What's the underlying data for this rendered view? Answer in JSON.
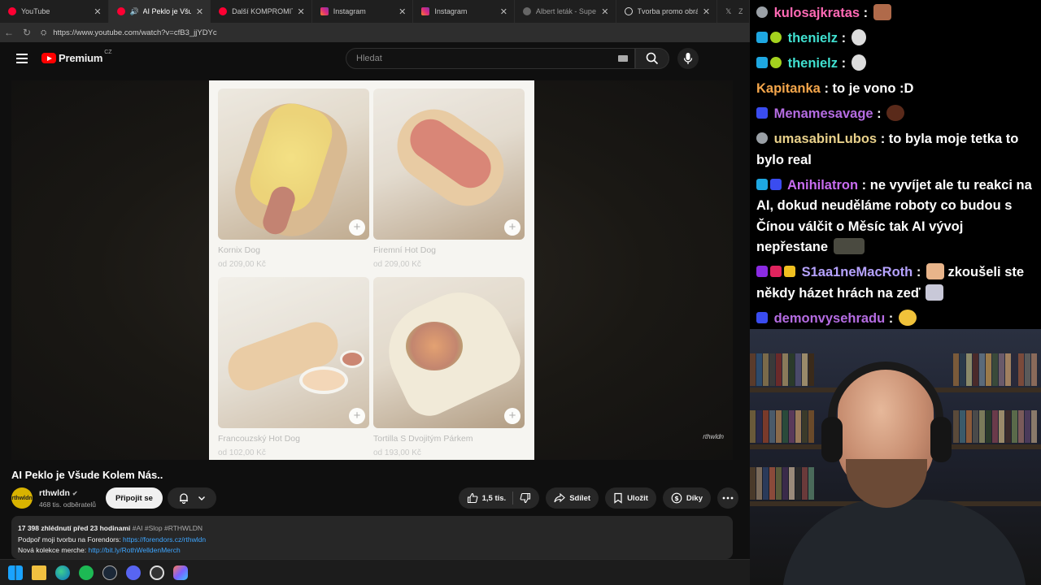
{
  "browser": {
    "tabs": [
      {
        "title": "YouTube",
        "active": false,
        "favicon_color": "#ff0033",
        "audio": false
      },
      {
        "title": "AI Peklo je Všude Ko",
        "active": true,
        "favicon_color": "#ff0033",
        "audio": true
      },
      {
        "title": "Další KOMPROMITUJÍCÍ",
        "active": false,
        "favicon_color": "#ff0033",
        "audio": false
      },
      {
        "title": "Instagram",
        "active": false,
        "favicon_color": "#e1306c",
        "audio": false
      },
      {
        "title": "Instagram",
        "active": false,
        "favicon_color": "#e1306c",
        "audio": false
      },
      {
        "title": "Albert leták - Supermarke",
        "active": false,
        "favicon_color": "#666666",
        "audio": false
      },
      {
        "title": "Tvorba promo obrázku",
        "active": false,
        "favicon_color": "#dddddd",
        "audio": false
      },
      {
        "title": "Zdeň",
        "active": false,
        "favicon_color": "#aaaaaa",
        "audio": false
      }
    ],
    "url": "https://www.youtube.com/watch?v=cfB3_jjYDYc"
  },
  "youtube": {
    "logo_text": "Premium",
    "country": "CZ",
    "search_placeholder": "Hledat",
    "video_title": "AI Peklo je Všude Kolem Nás..",
    "channel": {
      "name": "rthwldn",
      "subscribers": "468 tis. odběratelů",
      "avatar_text": "rthwldn"
    },
    "subscribe_label": "Připojit se",
    "likes": "1,5 tis.",
    "share_label": "Sdílet",
    "save_label": "Uložit",
    "thanks_label": "Díky",
    "description": {
      "views_date": "17 398 zhlédnutí  před 23 hodinami",
      "tags": "#AI #Slop #RTHWLDN",
      "line2_text": "Podpoř moji tvorbu na Forendors:",
      "line2_link": "https://forendors.cz/rthwldn",
      "line3_text": "Nová kolekce merche:",
      "line3_link": "http://bit.ly/RothWelldenMerch"
    },
    "watermark": "rthwldn",
    "menu_items": [
      {
        "name": "Kornix Dog",
        "price": "od 209,00 Kč"
      },
      {
        "name": "Firemní Hot Dog",
        "price": "od 209,00 Kč"
      },
      {
        "name": "Francouzský Hot Dog",
        "price": "od 102,00 Kč"
      },
      {
        "name": "Tortilla S Dvojitým Párkem",
        "price": "od 193,00 Kč"
      }
    ]
  },
  "chat": [
    {
      "user": "kulosajkratas",
      "color": "#ff69b4",
      "text": "",
      "badges": [
        "#9aa0a6"
      ],
      "emote": "#b06a4a"
    },
    {
      "user": "thenielz",
      "color": "#40e0d0",
      "text": "",
      "badges": [
        "#1ea7e1",
        "#a4d21e"
      ],
      "emote": "#dddddd"
    },
    {
      "user": "thenielz",
      "color": "#40e0d0",
      "text": "",
      "badges": [
        "#1ea7e1",
        "#a4d21e"
      ],
      "emote": "#dddddd"
    },
    {
      "user": "Kapitanka",
      "color": "#f4a64b",
      "text": "to je vono :D",
      "badges": [],
      "emote": ""
    },
    {
      "user": "Menamesavage",
      "color": "#b56ce2",
      "text": "",
      "badges": [
        "#3a4cf0"
      ],
      "emote": "#5a2a1a"
    },
    {
      "user": "umasabinLubos",
      "color": "#e8d08a",
      "text": "to byla moje tetka to bylo real",
      "badges": [
        "#9aa0a6"
      ],
      "emote": ""
    },
    {
      "user": "Anihilatron",
      "color": "#c86cf0",
      "text": "ne vyvíjet ale tu reakci na AI, dokud neuděláme roboty co budou s Čínou válčit o Měsíc tak AI vývoj nepřestane",
      "badges": [
        "#1ea7e1",
        "#3a4cf0"
      ],
      "emote": "#4a4a40"
    },
    {
      "user": "S1aa1neMacRoth",
      "color": "#b6a3ff",
      "text": "zkoušeli ste někdy házet hrách na zeď",
      "badges": [
        "#8a2be2",
        "#e0245e",
        "#f0c020"
      ],
      "emote": "#e8b48a"
    },
    {
      "user": "demonvysehradu",
      "color": "#b56ce2",
      "text": "",
      "badges": [
        "#3a4cf0"
      ],
      "emote": "#f0c23a"
    }
  ]
}
